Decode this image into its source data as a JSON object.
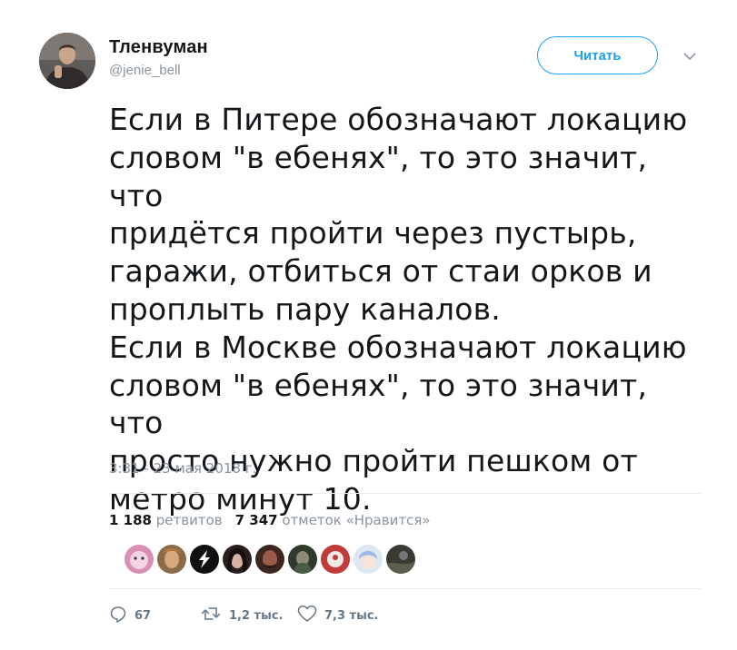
{
  "author": {
    "name": "Тленвуман",
    "handle": "@jenie_bell"
  },
  "follow_button_label": "Читать",
  "tweet_text": "Если в Питере обозначают локацию\nсловом \"в ебенях\", то это значит, что\nпридётся пройти через пустырь,\nгаражи, отбиться от стаи орков и\nпроплыть пару каналов.\nЕсли в Москве обозначают локацию\nсловом \"в ебенях\", то это значит, что\nпросто нужно пройти пешком от\nметро минут 10.",
  "timestamp": "3:31 - 23 мая 2018 г.",
  "stats": {
    "retweets_count": "1 188",
    "retweets_label": "ретвитов",
    "likes_count": "7 347",
    "likes_label": "отметок «Нравится»"
  },
  "actions": {
    "replies": "67",
    "retweets": "1,2 тыс.",
    "likes": "7,3 тыс."
  },
  "colors": {
    "accent": "#1da1f2",
    "muted": "#8a949e",
    "text": "#14171a"
  }
}
